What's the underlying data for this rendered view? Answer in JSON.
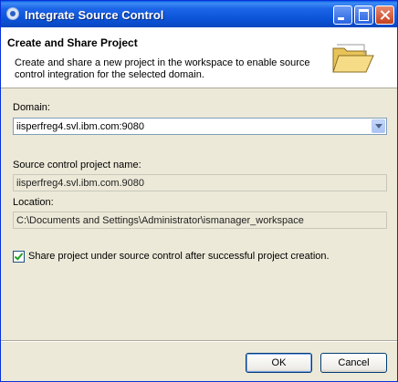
{
  "window": {
    "title": "Integrate Source Control"
  },
  "banner": {
    "title": "Create and Share Project",
    "description": "Create and share a new project in the workspace to enable source control integration for the selected domain.",
    "icon": "open-folder-icon"
  },
  "form": {
    "domain_label": "Domain:",
    "domain_value": "iisperfreg4.svl.ibm.com:9080",
    "project_name_label": "Source control project name:",
    "project_name_value": "iisperfreg4.svl.ibm.com.9080",
    "location_label": "Location:",
    "location_value": "C:\\Documents and Settings\\Administrator\\ismanager_workspace",
    "share_checkbox_label": "Share project under source control after successful project creation.",
    "share_checked": true
  },
  "buttons": {
    "ok": "OK",
    "cancel": "Cancel"
  },
  "colors": {
    "titlebar": "#0a53d6",
    "dialog_bg": "#ece9d8"
  }
}
